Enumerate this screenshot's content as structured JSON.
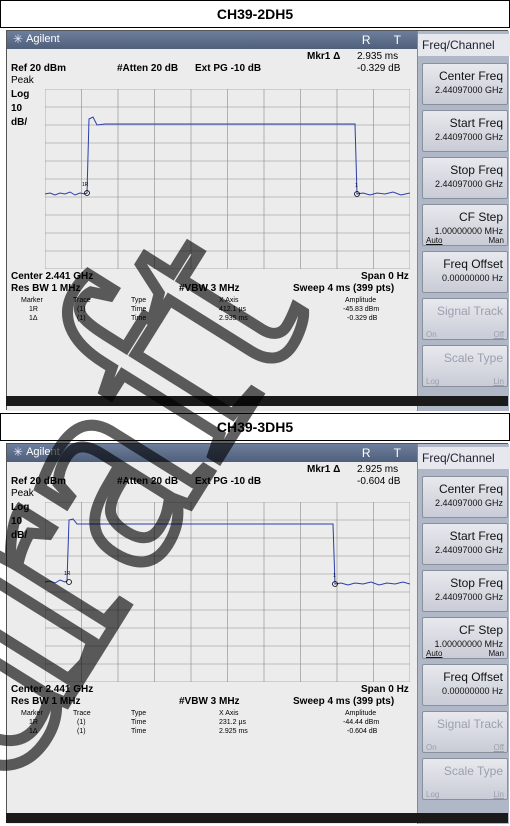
{
  "panels": [
    {
      "title": "CH39-2DH5",
      "brand": "Agilent",
      "rt": "R T",
      "mkr_label": "Mkr1 Δ",
      "mkr_time": "2.935 ms",
      "mkr_amp": "-0.329 dB",
      "ref": "Ref 20 dBm",
      "atten": "#Atten 20 dB",
      "ext_pg": "Ext PG -10 dB",
      "peak": "Peak",
      "log": "Log",
      "scale_val": "10",
      "scale_unit": "dB/",
      "center": "Center 2.441 GHz",
      "span": "Span 0 Hz",
      "res_bw": "Res BW 1 MHz",
      "vbw": "#VBW 3 MHz",
      "sweep": "Sweep 4 ms (399 pts)",
      "table_headers": [
        "Marker",
        "Trace",
        "Type",
        "X Axis",
        "Amplitude"
      ],
      "rows": [
        [
          "1R",
          "(1)",
          "Time",
          "412.1 µs",
          "-45.83 dBm"
        ],
        [
          "1Δ",
          "(1)",
          "Time",
          "2.935 ms",
          "-0.329 dB"
        ]
      ],
      "marker_labels": [
        "1R",
        "1"
      ]
    },
    {
      "title": "CH39-3DH5",
      "brand": "Agilent",
      "rt": "R T",
      "mkr_label": "Mkr1 Δ",
      "mkr_time": "2.925 ms",
      "mkr_amp": "-0.604 dB",
      "ref": "Ref 20 dBm",
      "atten": "#Atten 20 dB",
      "ext_pg": "Ext PG -10 dB",
      "peak": "Peak",
      "log": "Log",
      "scale_val": "10",
      "scale_unit": "dB/",
      "center": "Center 2.441 GHz",
      "span": "Span 0 Hz",
      "res_bw": "Res BW 1 MHz",
      "vbw": "#VBW 3 MHz",
      "sweep": "Sweep 4 ms (399 pts)",
      "table_headers": [
        "Marker",
        "Trace",
        "Type",
        "X Axis",
        "Amplitude"
      ],
      "rows": [
        [
          "1R",
          "(1)",
          "Time",
          "231.2 µs",
          "-44.44 dBm"
        ],
        [
          "1Δ",
          "(1)",
          "Time",
          "2.925 ms",
          "-0.604 dB"
        ]
      ],
      "marker_labels": [
        "1R",
        "1"
      ]
    }
  ],
  "sidebar": {
    "menu_title": "Freq/Channel",
    "keys": [
      {
        "label": "Center Freq",
        "value": "2.44097000 GHz"
      },
      {
        "label": "Start Freq",
        "value": "2.44097000 GHz"
      },
      {
        "label": "Stop Freq",
        "value": "2.44097000 GHz"
      },
      {
        "label": "CF Step",
        "value": "1.00000000 MHz",
        "opt_left": "Auto",
        "opt_right": "Man"
      },
      {
        "label": "Freq Offset",
        "value": "0.00000000  Hz"
      },
      {
        "label": "Signal Track",
        "opt_left": "On",
        "opt_right": "Off",
        "disabled": true
      },
      {
        "label": "Scale Type",
        "opt_left": "Log",
        "opt_right": "Lin",
        "disabled": true
      }
    ]
  },
  "watermark": "draft",
  "colors": {
    "trace": "#2a3ea8",
    "grid": "#8a8a8a",
    "watermark": "#000000"
  }
}
